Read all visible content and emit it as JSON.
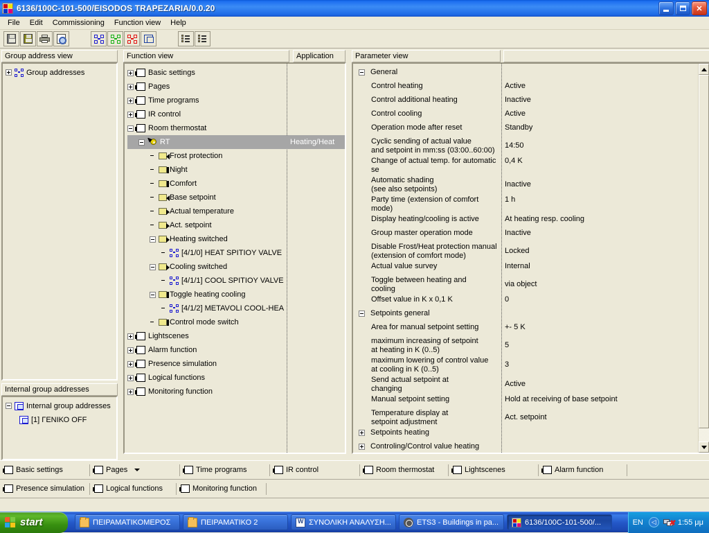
{
  "window": {
    "title": "6136/100C-101-500/EISODOS TRAPEZARIA/0.0.20",
    "icon": "knx-app-icon",
    "buttons": {
      "minimize": "minimize-button",
      "maximize": "maximize-button",
      "close": "close-button"
    }
  },
  "menu": {
    "items": [
      {
        "label": "File"
      },
      {
        "label": "Edit"
      },
      {
        "label": "Commissioning"
      },
      {
        "label": "Function view"
      },
      {
        "label": "Help"
      }
    ]
  },
  "toolbar": {
    "buttons": [
      {
        "name": "open-button",
        "icon": "disk-icon"
      },
      {
        "name": "save-button",
        "icon": "save-icon"
      },
      {
        "name": "print-button",
        "icon": "printer-icon"
      },
      {
        "name": "print-preview-button",
        "icon": "print-preview-icon"
      },
      {
        "name": "group-address-blue-button",
        "icon": "knx-group-icon"
      },
      {
        "name": "group-address-green-button",
        "icon": "knx-group-icon"
      },
      {
        "name": "group-address-red-button",
        "icon": "knx-group-icon"
      },
      {
        "name": "internal-group-address-button",
        "icon": "internal-group-icon"
      },
      {
        "name": "detail-list-button",
        "icon": "list-detail-icon"
      },
      {
        "name": "list-view-button",
        "icon": "list-view-icon"
      }
    ]
  },
  "group_address_view": {
    "header": "Group address view",
    "root": {
      "label": "Group addresses",
      "expander": "plus",
      "icon": "knx-group-icon"
    }
  },
  "internal_group_addresses": {
    "header": "Internal group addresses",
    "root": {
      "label": "Internal group addresses",
      "expander": "minus",
      "icon": "internal-group-icon"
    },
    "children": [
      {
        "label": "[1] ΓΕΝΙΚΟ OFF",
        "icon": "internal-group-icon"
      }
    ]
  },
  "function_view": {
    "header": "Function view",
    "application_header": "Application",
    "nodes": [
      {
        "label": "Basic settings",
        "indent": 0,
        "expander": "plus",
        "icon": "function-icon"
      },
      {
        "label": "Pages",
        "indent": 0,
        "expander": "plus",
        "icon": "function-icon"
      },
      {
        "label": "Time programs",
        "indent": 0,
        "expander": "plus",
        "icon": "function-icon"
      },
      {
        "label": "IR control",
        "indent": 0,
        "expander": "plus",
        "icon": "function-icon"
      },
      {
        "label": "Room thermostat",
        "indent": 0,
        "expander": "minus",
        "icon": "function-icon"
      },
      {
        "label": "RT",
        "indent": 1,
        "expander": "minus",
        "icon": "gear-icon",
        "selected": true,
        "application": "Heating/Heat"
      },
      {
        "label": "Frost protection",
        "indent": 2,
        "expander": "none",
        "icon": "object-in-icon"
      },
      {
        "label": "Night",
        "indent": 2,
        "expander": "none",
        "icon": "object-both-icon"
      },
      {
        "label": "Comfort",
        "indent": 2,
        "expander": "none",
        "icon": "object-both-icon"
      },
      {
        "label": "Base setpoint",
        "indent": 2,
        "expander": "none",
        "icon": "object-in-icon"
      },
      {
        "label": "Actual temperature",
        "indent": 2,
        "expander": "none",
        "icon": "object-out-icon"
      },
      {
        "label": "Act. setpoint",
        "indent": 2,
        "expander": "none",
        "icon": "object-out-icon"
      },
      {
        "label": "Heating switched",
        "indent": 2,
        "expander": "minus",
        "icon": "object-out-icon"
      },
      {
        "label": "[4/1/0] HEAT SPITIOY VALVE",
        "indent": 3,
        "expander": "none",
        "icon": "knx-group-icon"
      },
      {
        "label": "Cooling switched",
        "indent": 2,
        "expander": "minus",
        "icon": "object-out-icon"
      },
      {
        "label": "[4/1/1] COOL SPITIOY VALVE",
        "indent": 3,
        "expander": "none",
        "icon": "knx-group-icon"
      },
      {
        "label": "Toggle heating cooling",
        "indent": 2,
        "expander": "minus",
        "icon": "object-both-icon"
      },
      {
        "label": "[4/1/2] METAVOLI COOL-HEA",
        "indent": 3,
        "expander": "none",
        "icon": "knx-group-icon"
      },
      {
        "label": "Control mode switch",
        "indent": 2,
        "expander": "none",
        "icon": "object-both-icon"
      },
      {
        "label": "Lightscenes",
        "indent": 0,
        "expander": "plus",
        "icon": "function-icon"
      },
      {
        "label": "Alarm function",
        "indent": 0,
        "expander": "plus",
        "icon": "function-icon"
      },
      {
        "label": "Presence simulation",
        "indent": 0,
        "expander": "plus",
        "icon": "function-icon"
      },
      {
        "label": "Logical functions",
        "indent": 0,
        "expander": "plus",
        "icon": "function-icon"
      },
      {
        "label": "Monitoring function",
        "indent": 0,
        "expander": "plus",
        "icon": "function-icon"
      }
    ]
  },
  "parameter_view": {
    "header": "Parameter view",
    "header2": "",
    "rows": [
      {
        "type": "group",
        "expander": "minus",
        "name": "General",
        "value": ""
      },
      {
        "type": "param",
        "name": "Control heating",
        "value": "Active"
      },
      {
        "type": "param",
        "name": "Control additional heating",
        "value": "Inactive"
      },
      {
        "type": "param",
        "name": "Control cooling",
        "value": "Active"
      },
      {
        "type": "param",
        "name": "Operation mode after reset",
        "value": "Standby"
      },
      {
        "type": "param",
        "name": "Cyclic sending of actual value",
        "name2": "and setpoint in mm:ss (03:00..60:00)",
        "value": "14:50"
      },
      {
        "type": "param",
        "name": "Change of actual temp. for automatic se",
        "value": "0,4 K"
      },
      {
        "type": "param",
        "name": "Automatic shading",
        "name2": "(see also setpoints)",
        "value": "Inactive"
      },
      {
        "type": "param",
        "name": "Party time (extension of comfort mode)",
        "value": "1 h"
      },
      {
        "type": "param",
        "name": "Display heating/cooling is active",
        "value": "At heating resp. cooling"
      },
      {
        "type": "param",
        "name": "Group master operation mode",
        "value": "Inactive"
      },
      {
        "type": "param",
        "name": "Disable Frost/Heat protection manual",
        "name2": "(extension of comfort mode)",
        "value": "Locked"
      },
      {
        "type": "param",
        "name": "Actual value survey",
        "value": "Internal"
      },
      {
        "type": "param",
        "name": "Toggle between heating and",
        "name2": "cooling",
        "value": "via object"
      },
      {
        "type": "param",
        "name": "Offset value in K x 0,1 K",
        "value": "0"
      },
      {
        "type": "group",
        "expander": "minus",
        "name": "Setpoints general",
        "value": ""
      },
      {
        "type": "param",
        "name": "Area for manual setpoint setting",
        "value": "+- 5 K"
      },
      {
        "type": "param",
        "name": "maximum increasing of setpoint",
        "name2": "at heating in K (0..5)",
        "value": "5"
      },
      {
        "type": "param",
        "name": "maximum lowering of control value",
        "name2": "at cooling in K (0..5)",
        "value": "3"
      },
      {
        "type": "param",
        "name": "Send actual setpoint at",
        "name2": "changing",
        "value": "Active"
      },
      {
        "type": "param",
        "name": "Manual setpoint setting",
        "value": "Hold at receiving of base setpoint"
      },
      {
        "type": "param",
        "name": "Temperature display at",
        "name2": "setpoint adjustment",
        "value": "Act. setpoint"
      },
      {
        "type": "group",
        "expander": "plus",
        "name": "Setpoints heating",
        "value": ""
      },
      {
        "type": "group",
        "expander": "plus",
        "name": "Controling/Control value heating",
        "value": ""
      }
    ],
    "scrollbar": {
      "up": "scroll-up-arrow",
      "down": "scroll-down-arrow"
    }
  },
  "function_tabs": {
    "row1": [
      {
        "label": "Basic settings",
        "caret": false
      },
      {
        "label": "Pages",
        "caret": true
      },
      {
        "label": "Time programs",
        "caret": false
      },
      {
        "label": "IR control",
        "caret": false
      },
      {
        "label": "Room thermostat",
        "caret": false
      },
      {
        "label": "Lightscenes",
        "caret": false
      },
      {
        "label": "Alarm function",
        "caret": false
      }
    ],
    "row2": [
      {
        "label": "Presence simulation",
        "caret": false
      },
      {
        "label": "Logical functions",
        "caret": false
      },
      {
        "label": "Monitoring function",
        "caret": false
      }
    ]
  },
  "taskbar": {
    "start_label": "start",
    "tasks": [
      {
        "label": "ΠΕΙΡΑΜΑΤΙΚΟΜΕΡΟΣ",
        "icon": "folder-icon",
        "active": false
      },
      {
        "label": "ΠΕΙΡΑΜΑΤΙΚΟ 2",
        "icon": "folder-icon",
        "active": false
      },
      {
        "label": "ΣΥΝΟΛΙΚΗ ΑΝΑΛΥΣΗ...",
        "icon": "word-document-icon",
        "active": false
      },
      {
        "label": "ETS3 - Buildings in pa...",
        "icon": "ets-icon",
        "active": false
      },
      {
        "label": "6136/100C-101-500/...",
        "icon": "knx-app-icon",
        "active": true
      }
    ],
    "tray": {
      "language": "EN",
      "clock": "1:55 μμ",
      "chevron": "show-hidden-icons",
      "network": "network-disconnected-icon"
    }
  },
  "colors": {
    "window_face": "#ece9d8",
    "titlebar_blue": "#3b8bf5",
    "selection_gray": "#a6a6a6",
    "knx_blue": "#1a1ad0",
    "taskbar_blue": "#2458c8",
    "start_green": "#5eb82b"
  }
}
